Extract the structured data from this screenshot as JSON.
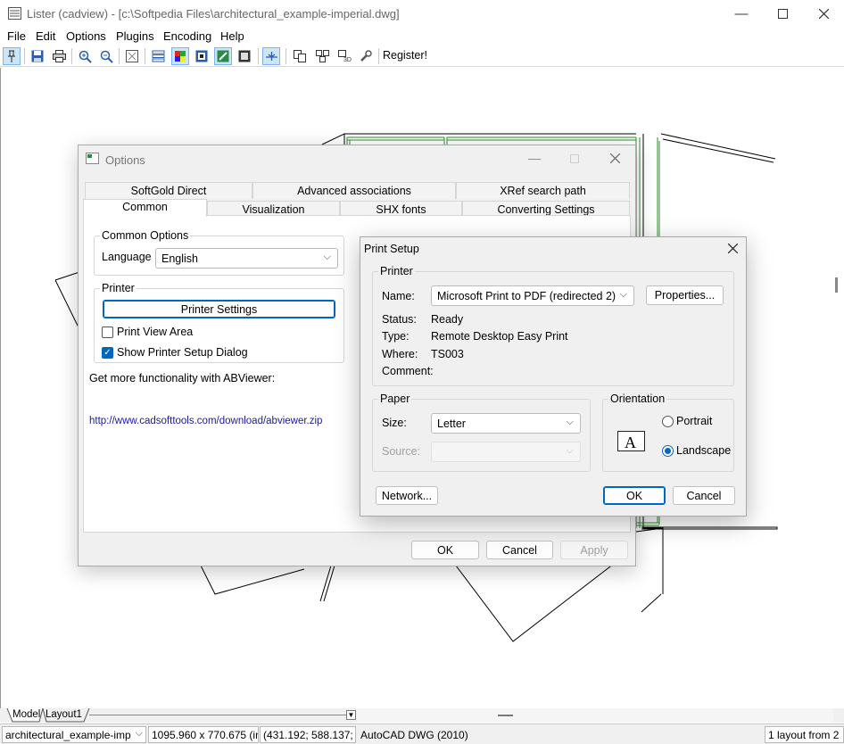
{
  "window": {
    "title": "Lister (cadview) - [c:\\Softpedia Files\\architectural_example-imperial.dwg]"
  },
  "menu": [
    "File",
    "Edit",
    "Options",
    "Plugins",
    "Encoding",
    "Help"
  ],
  "toolbar": {
    "register_label": "Register!"
  },
  "layout_tabs": [
    "Model",
    "Layout1"
  ],
  "status": {
    "file": "architectural_example-imp",
    "size": "1095.960 x 770.675 (in)",
    "coords": "(431.192; 588.137; 0)",
    "format": "AutoCAD DWG (2010)",
    "layouts": "1 layout from 2"
  },
  "options_dialog": {
    "title": "Options",
    "tabs_row1": [
      "SoftGold Direct",
      "Advanced associations",
      "XRef search path"
    ],
    "tabs_row2": [
      "Common",
      "Visualization",
      "SHX fonts",
      "Converting Settings"
    ],
    "common_options_label": "Common Options",
    "language_label": "Language",
    "language_value": "English",
    "printer_label": "Printer",
    "printer_settings_button": "Printer Settings",
    "print_view_area": "Print View Area",
    "show_printer_setup": "Show Printer Setup Dialog",
    "more_text": "Get more functionality with ABViewer:",
    "link": "http://www.cadsofttools.com/download/abviewer.zip",
    "ok": "OK",
    "cancel": "Cancel",
    "apply": "Apply"
  },
  "print_setup": {
    "title": "Print Setup",
    "printer_group": "Printer",
    "name_label": "Name:",
    "name_value": "Microsoft Print to PDF (redirected 2)",
    "properties_button": "Properties...",
    "status_label": "Status:",
    "status_value": "Ready",
    "type_label": "Type:",
    "type_value": "Remote Desktop Easy Print",
    "where_label": "Where:",
    "where_value": "TS003",
    "comment_label": "Comment:",
    "paper_group": "Paper",
    "size_label": "Size:",
    "size_value": "Letter",
    "source_label": "Source:",
    "orientation_group": "Orientation",
    "portrait": "Portrait",
    "landscape": "Landscape",
    "network_button": "Network...",
    "ok": "OK",
    "cancel": "Cancel"
  }
}
